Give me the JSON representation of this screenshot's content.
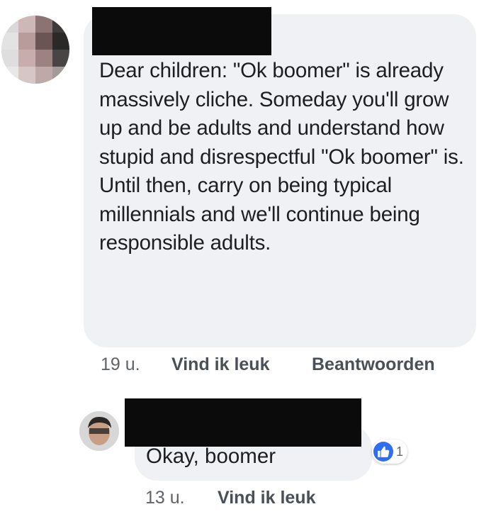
{
  "comment": {
    "text": "Dear children: \"Ok boomer\" is already massively cliche. Someday you'll grow up and be adults and understand how stupid and disrespectful \"Ok boomer\" is. Until then, carry on being typical millennials and we'll continue being responsible adults.",
    "time": "19 u.",
    "like_label": "Vind ik leuk",
    "reply_label": "Beantwoorden"
  },
  "reply": {
    "text": "Okay, boomer",
    "time": "13 u.",
    "like_label": "Vind ik leuk",
    "reaction_count": "1",
    "reaction_icon": "thumbs-up-icon",
    "reaction_color": "#2e6ff2"
  },
  "colors": {
    "bubble": "#eff1f4",
    "redaction": "#0b0b0b",
    "meta_text": "#4b4f56"
  }
}
